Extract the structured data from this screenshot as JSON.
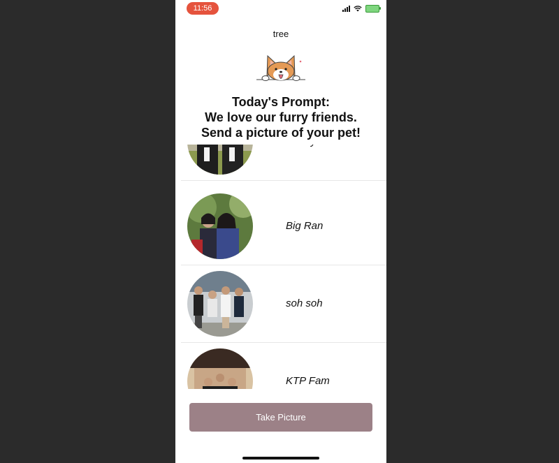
{
  "status_bar": {
    "time": "11:56"
  },
  "header": {
    "title": "tree"
  },
  "prompt": {
    "line1": "Today's Prompt:",
    "line2": "We love our furry friends.",
    "line3": "Send a picture of your pet!"
  },
  "groups": [
    {
      "name": "kimmys"
    },
    {
      "name": "Big Ran"
    },
    {
      "name": "soh soh"
    },
    {
      "name": "KTP Fam"
    }
  ],
  "actions": {
    "take_picture": "Take Picture"
  },
  "colors": {
    "button": "#9c8187",
    "time_pill": "#e5533d"
  }
}
